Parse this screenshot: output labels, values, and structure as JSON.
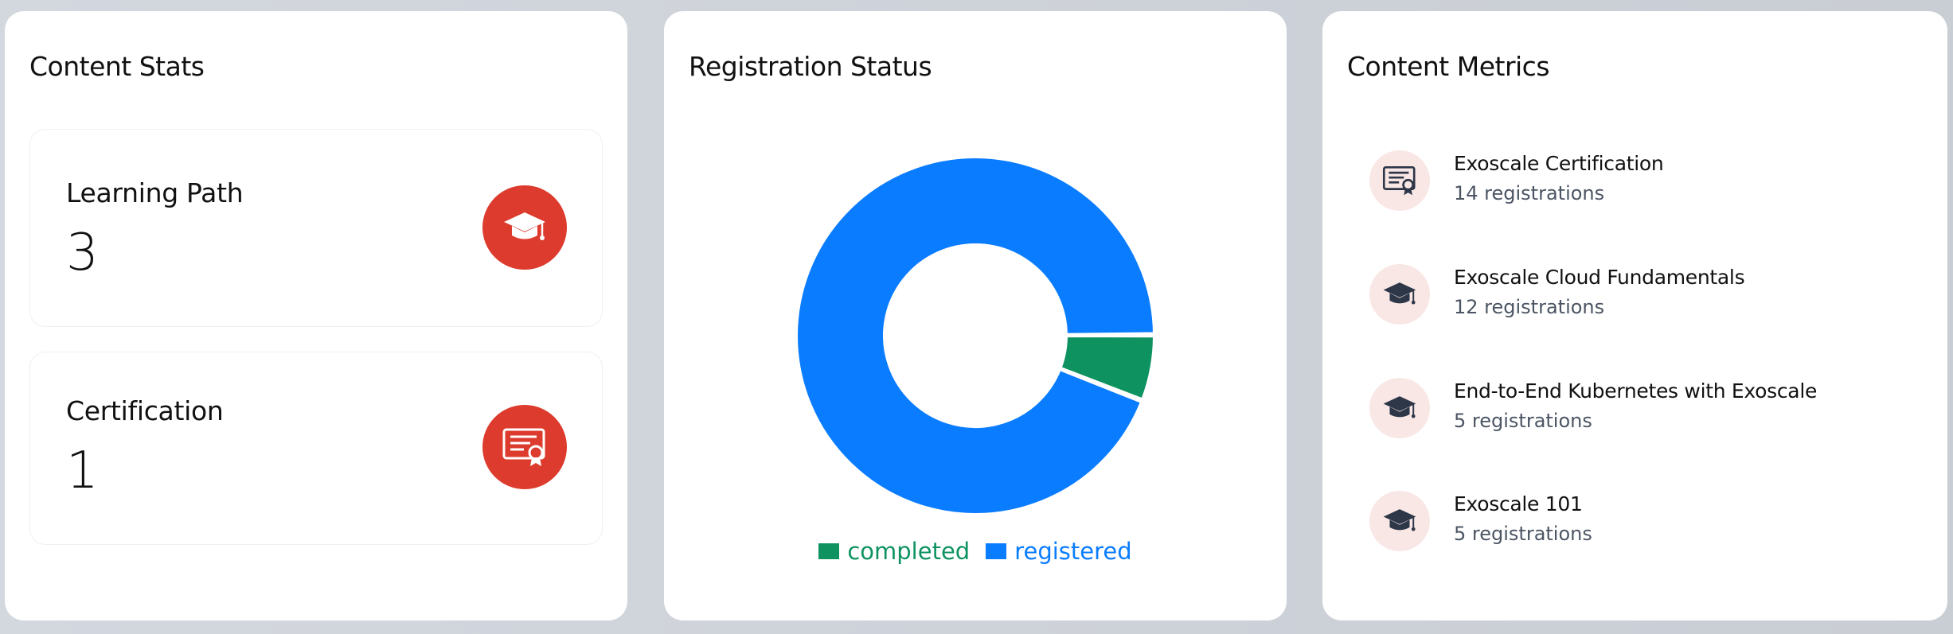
{
  "content_stats": {
    "title": "Content Stats",
    "items": [
      {
        "label": "Learning Path",
        "value": "3",
        "icon": "graduation-cap-icon"
      },
      {
        "label": "Certification",
        "value": "1",
        "icon": "certificate-icon"
      }
    ]
  },
  "registration_status": {
    "title": "Registration Status",
    "legend": [
      {
        "label": "completed",
        "color": "#0e9360"
      },
      {
        "label": "registered",
        "color": "#0a7cff"
      }
    ]
  },
  "chart_data": {
    "type": "pie",
    "labels": [
      "completed",
      "registered"
    ],
    "values": [
      6,
      94
    ],
    "colors": [
      "#0e9360",
      "#0a7cff"
    ]
  },
  "content_metrics": {
    "title": "Content Metrics",
    "items": [
      {
        "name": "Exoscale Certification",
        "sub": "14 registrations",
        "icon": "certificate-icon"
      },
      {
        "name": "Exoscale Cloud Fundamentals",
        "sub": "12 registrations",
        "icon": "graduation-cap-icon"
      },
      {
        "name": "End-to-End Kubernetes with Exoscale",
        "sub": "5 registrations",
        "icon": "graduation-cap-icon"
      },
      {
        "name": "Exoscale 101",
        "sub": "5 registrations",
        "icon": "graduation-cap-icon"
      }
    ]
  },
  "colors": {
    "accent_red": "#dc3b2d",
    "icon_bg_pink": "#f9e7e5"
  }
}
